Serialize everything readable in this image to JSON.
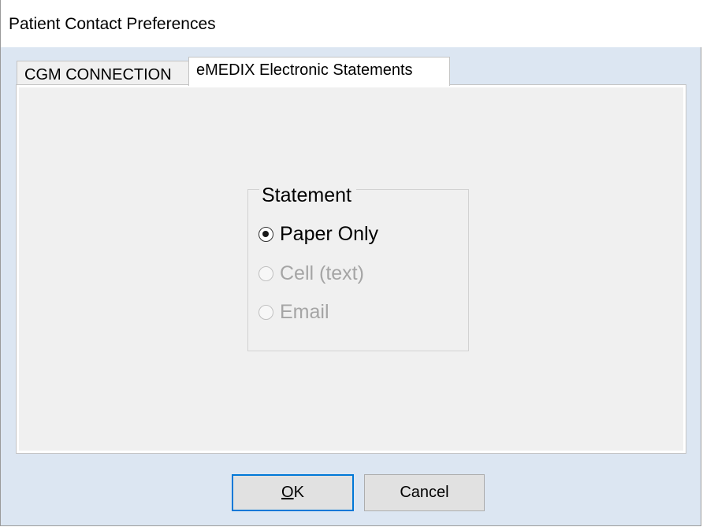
{
  "window": {
    "title": "Patient Contact Preferences"
  },
  "tabs": [
    {
      "label": "CGM CONNECTION",
      "active": false
    },
    {
      "label": "eMEDIX Electronic Statements",
      "active": true
    }
  ],
  "statement_group": {
    "legend": "Statement",
    "options": [
      {
        "label": "Paper Only",
        "selected": true,
        "enabled": true
      },
      {
        "label": "Cell (text)",
        "selected": false,
        "enabled": false
      },
      {
        "label": "Email",
        "selected": false,
        "enabled": false
      }
    ]
  },
  "buttons": {
    "ok_mnemonic": "O",
    "ok_rest": "K",
    "cancel_label": "Cancel"
  },
  "colors": {
    "dialog_background": "#dce6f2",
    "panel_background": "#f0f0f0",
    "focus_border": "#0078d7"
  }
}
